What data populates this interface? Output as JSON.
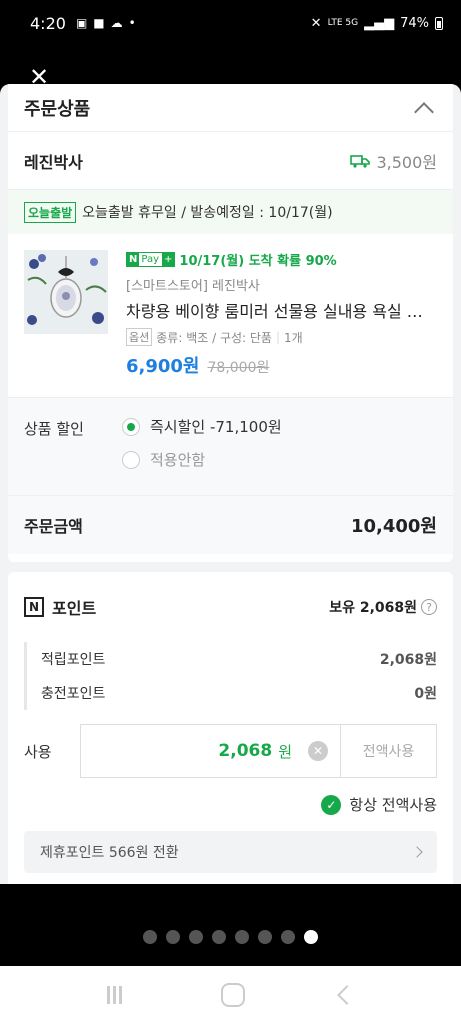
{
  "status_bar": {
    "time": "4:20",
    "battery": "74%",
    "network": "LTE 5G"
  },
  "order": {
    "section_title": "주문상품",
    "seller": "레진박사",
    "shipping_fee": "3,500원",
    "today_badge": "오늘출발",
    "ship_info": "오늘출발 휴무일 / 발송예정일 : 10/17(월)",
    "product": {
      "npay_n": "N",
      "npay_pay": "Pay",
      "npay_plus": "+",
      "arrival": "10/17(월) 도착 확률 90%",
      "store": "[스마트스토어] 레진박사",
      "title": "차량용 베이향 룸미러 선물용 실내용 욕실 방향제",
      "option_tag": "옵션",
      "option_text": "종류: 백조 / 구성: 단품",
      "quantity": "1개",
      "price": "6,900원",
      "original_price": "78,000원"
    },
    "discount": {
      "label": "상품 할인",
      "option_instant": "즉시할인 -71,100원",
      "option_none": "적용안함"
    },
    "total_label": "주문금액",
    "total_amount": "10,400원"
  },
  "point": {
    "title": "포인트",
    "balance": "보유 2,068원",
    "help": "?",
    "accum_label": "적립포인트",
    "accum_value": "2,068원",
    "charge_label": "충전포인트",
    "charge_value": "0원",
    "use_label": "사용",
    "use_value": "2,068",
    "use_unit": "원",
    "use_all": "전액사용",
    "always_use": "항상 전액사용",
    "convert": "제휴포인트 566원 전환"
  },
  "pager": {
    "count": 8,
    "active_index": 7
  },
  "colors": {
    "accent_green": "#17a84a",
    "price_blue": "#1f7fe0"
  }
}
